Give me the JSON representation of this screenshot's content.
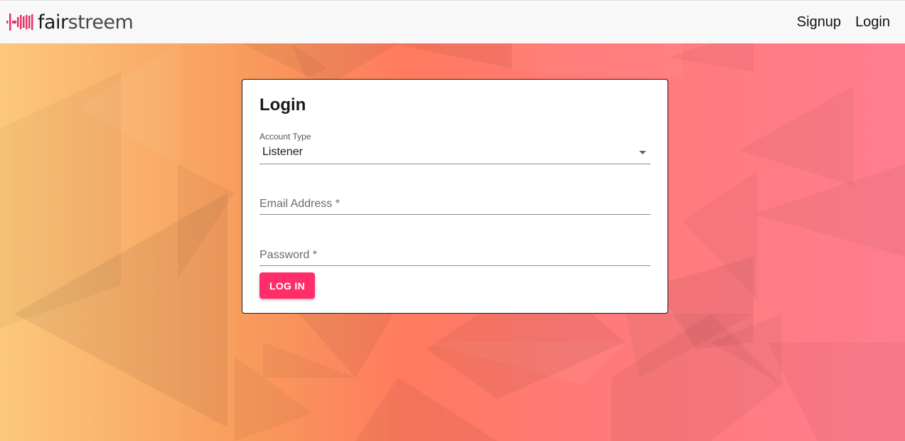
{
  "brand": {
    "name_part1": "fair",
    "name_part2": "streem",
    "logo_icon": "soundwave-icon",
    "accent_color": "#e8336b"
  },
  "nav": {
    "signup": "Signup",
    "login": "Login"
  },
  "login_card": {
    "title": "Login",
    "account_type": {
      "label": "Account Type",
      "value": "Listener",
      "icon": "dropdown-arrow-icon"
    },
    "email": {
      "placeholder": "Email Address *",
      "value": ""
    },
    "password": {
      "placeholder": "Password *",
      "value": ""
    },
    "submit_label": "LOG IN",
    "button_color": "#ff2d6a"
  }
}
